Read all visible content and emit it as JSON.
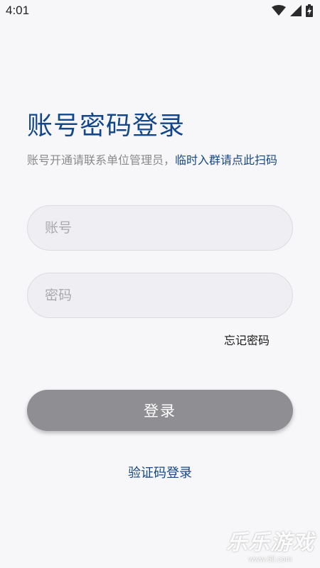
{
  "status_bar": {
    "time": "4:01"
  },
  "login": {
    "title": "账号密码登录",
    "subtitle_text": "账号开通请联系单位管理员，",
    "subtitle_link": "临时入群请点此扫码",
    "account_placeholder": "账号",
    "password_placeholder": "密码",
    "forgot_password": "忘记密码",
    "login_button": "登录",
    "code_login": "验证码登录"
  },
  "watermark": {
    "brand": "乐乐游戏",
    "url": "www.6ll.com"
  },
  "icons": [
    "wifi-icon",
    "cell-signal-icon",
    "battery-charging-icon"
  ],
  "colors": {
    "accent": "#14478a",
    "button": "#8f8f93",
    "background": "#f7f7f9",
    "field_background": "#efeff3"
  }
}
